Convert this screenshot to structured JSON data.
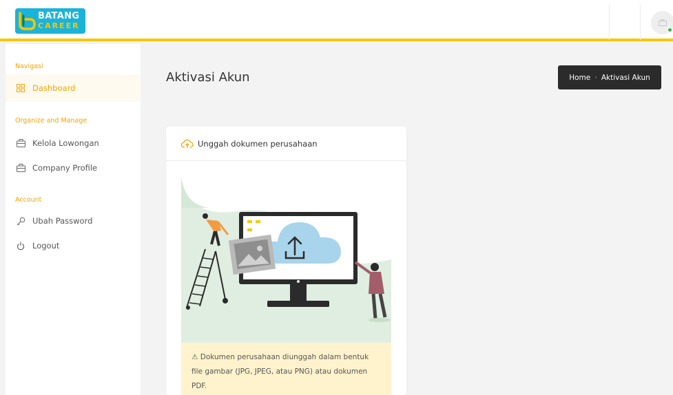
{
  "brand": {
    "line1": "BATANG",
    "line2": "CAREER"
  },
  "sidebar": {
    "sections": [
      {
        "title": "Navigasi"
      },
      {
        "title": "Organize and Manage"
      },
      {
        "title": "Account"
      }
    ],
    "items": [
      {
        "label": "Dashboard",
        "icon": "dashboard-icon"
      },
      {
        "label": "Kelola Lowongan",
        "icon": "briefcase-icon"
      },
      {
        "label": "Company Profile",
        "icon": "briefcase-icon"
      },
      {
        "label": "Ubah Password",
        "icon": "key-icon"
      },
      {
        "label": "Logout",
        "icon": "power-icon"
      }
    ]
  },
  "page": {
    "title": "Aktivasi Akun"
  },
  "breadcrumb": {
    "home": "Home",
    "current": "Aktivasi Akun"
  },
  "upload_card": {
    "title": "Unggah dokumen perusahaan",
    "icon": "cloud-upload-icon",
    "notice": "⚠ Dokumen perusahaan diunggah dalam bentuk file gambar (JPG, JPEG, atau PNG) atau dokumen PDF."
  },
  "colors": {
    "accent": "#f6c700",
    "active_text": "#f0a500",
    "breadcrumb_bg": "#2b2b2b",
    "notice_bg": "#fff3cd",
    "logo_bg": "#1bb3d9"
  }
}
